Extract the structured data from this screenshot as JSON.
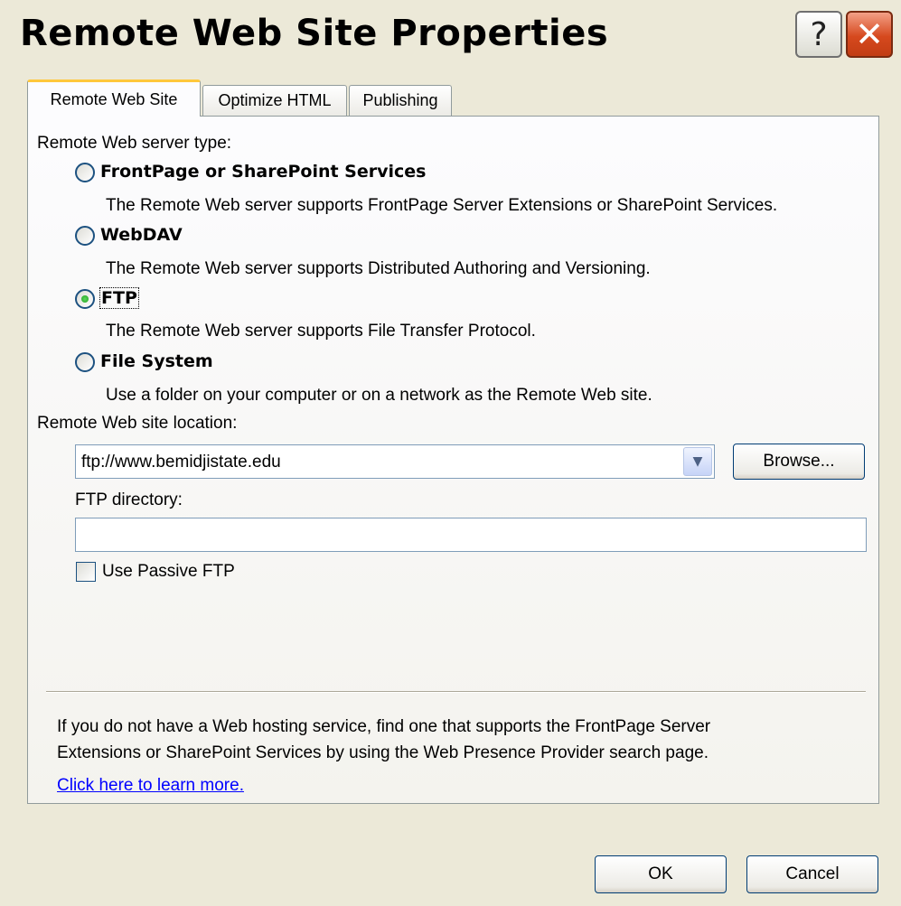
{
  "window": {
    "title": "Remote Web Site Properties",
    "help_button": "?",
    "close_button": "✕"
  },
  "tabs": [
    {
      "label": "Remote Web Site",
      "active": true
    },
    {
      "label": "Optimize HTML",
      "active": false
    },
    {
      "label": "Publishing",
      "active": false
    }
  ],
  "server_type": {
    "group_label": "Remote Web server type:",
    "options": [
      {
        "label": "FrontPage or SharePoint Services",
        "description": "The Remote Web server supports FrontPage Server Extensions or SharePoint Services.",
        "checked": false
      },
      {
        "label": "WebDAV",
        "description": "The Remote Web server supports Distributed Authoring and Versioning.",
        "checked": false
      },
      {
        "label": "FTP",
        "description": "The Remote Web server supports File Transfer Protocol.",
        "checked": true
      },
      {
        "label": "File System",
        "description": "Use a folder on your computer or on a network as the Remote Web site.",
        "checked": false
      }
    ]
  },
  "location": {
    "label": "Remote Web site location:",
    "value": "ftp://www.bemidjistate.edu",
    "browse_label": "Browse..."
  },
  "ftp": {
    "directory_label": "FTP directory:",
    "directory_value": "",
    "passive_label": "Use Passive FTP",
    "passive_checked": false
  },
  "info": {
    "line1": "If you do not have a Web hosting service, find one that supports the FrontPage Server",
    "line2": "Extensions or SharePoint Services by using the Web Presence Provider search page.",
    "link": "Click here to learn more."
  },
  "footer": {
    "ok_label": "OK",
    "cancel_label": "Cancel"
  }
}
